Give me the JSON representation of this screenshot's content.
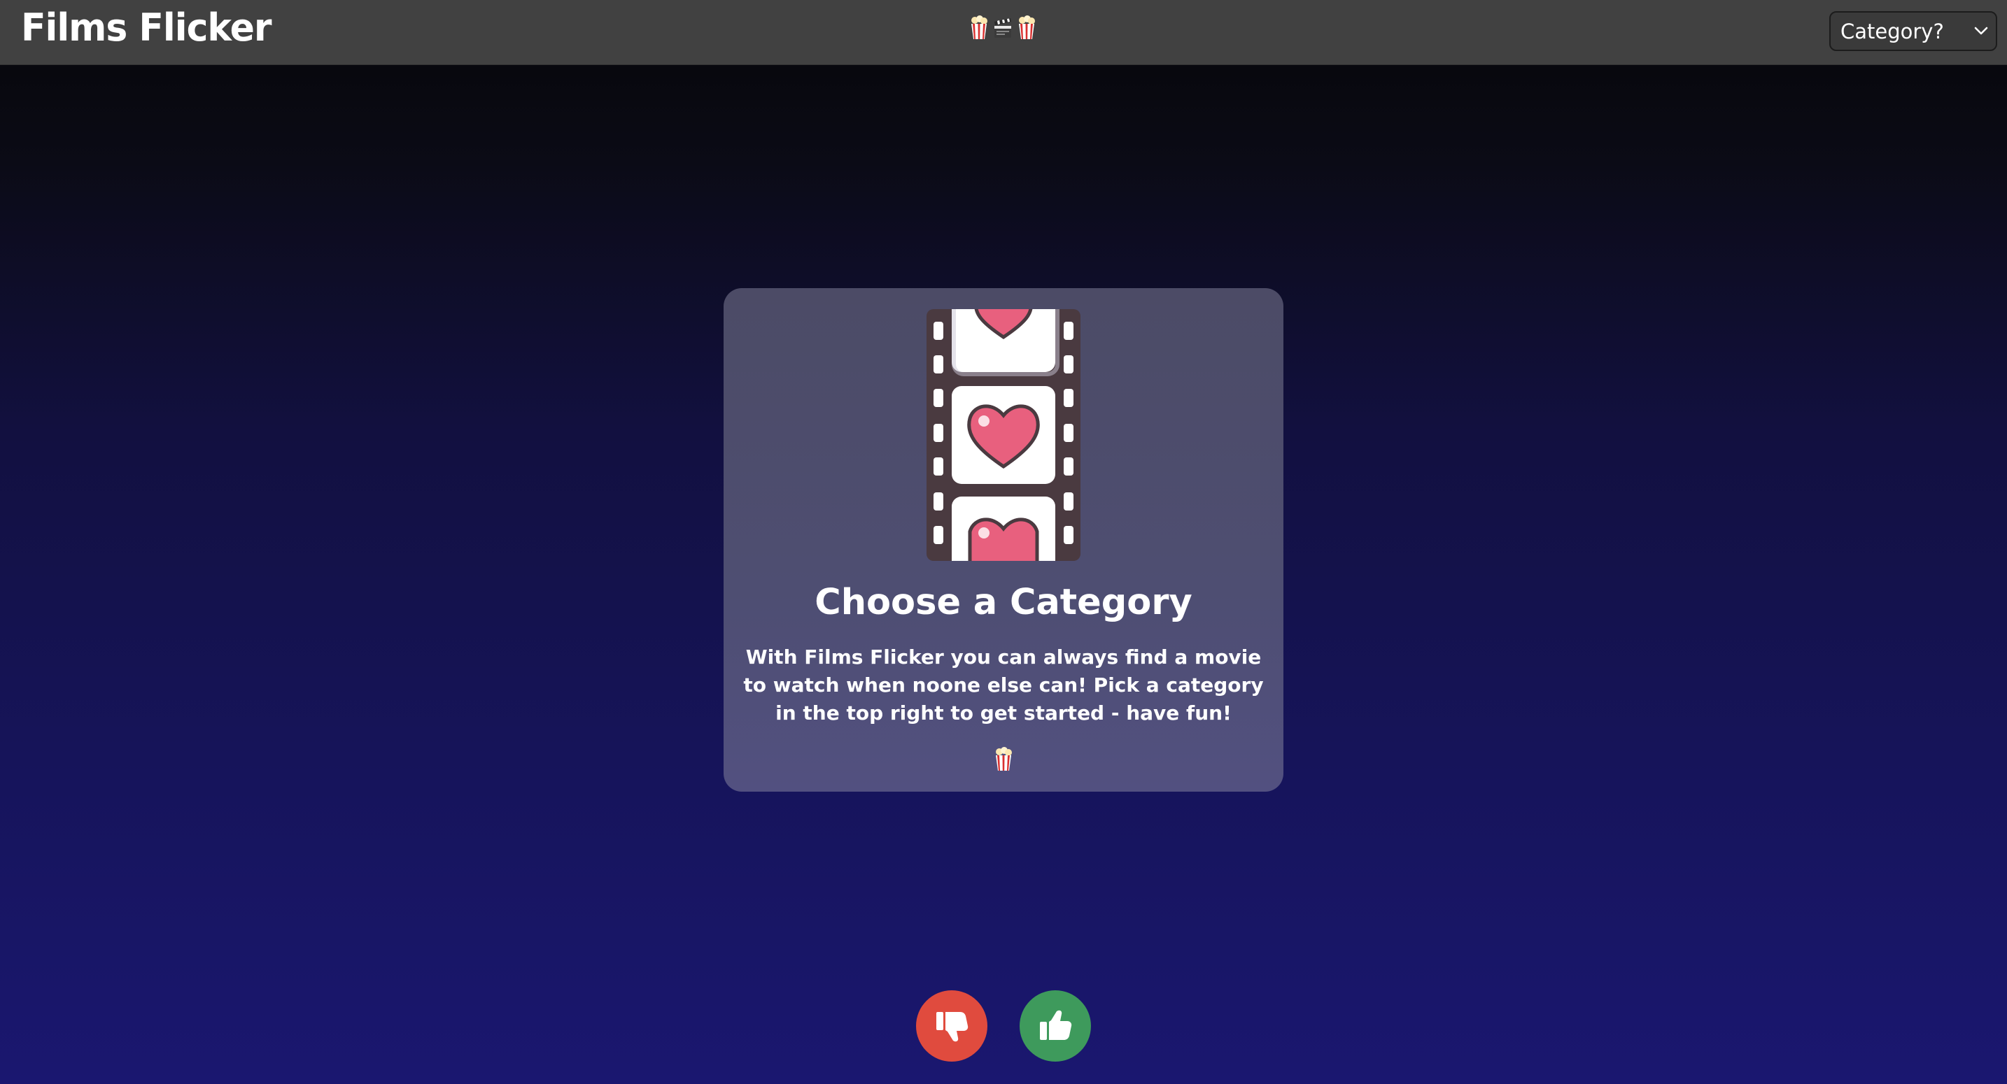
{
  "app": {
    "logo": "Films Flicker",
    "header_emojis": [
      "popcorn-icon",
      "clapperboard-icon",
      "popcorn-icon"
    ]
  },
  "category_select": {
    "selected": "Category?",
    "options": [
      "Category?"
    ]
  },
  "card": {
    "image": "film-strip-heart-icon",
    "title": "Choose a Category",
    "description": "With Films Flicker you can always find a movie to watch when noone else can! Pick a category in the top right to get started - have fun!",
    "footer_emoji": "popcorn-icon"
  },
  "actions": {
    "dislike_icon": "thumbs-down-icon",
    "like_icon": "thumbs-up-icon"
  },
  "colors": {
    "navbar": "#414141",
    "card": "#4e4e72",
    "dislike": "#e04b3e",
    "like": "#3e9a5c",
    "heart": "#e8607e"
  }
}
